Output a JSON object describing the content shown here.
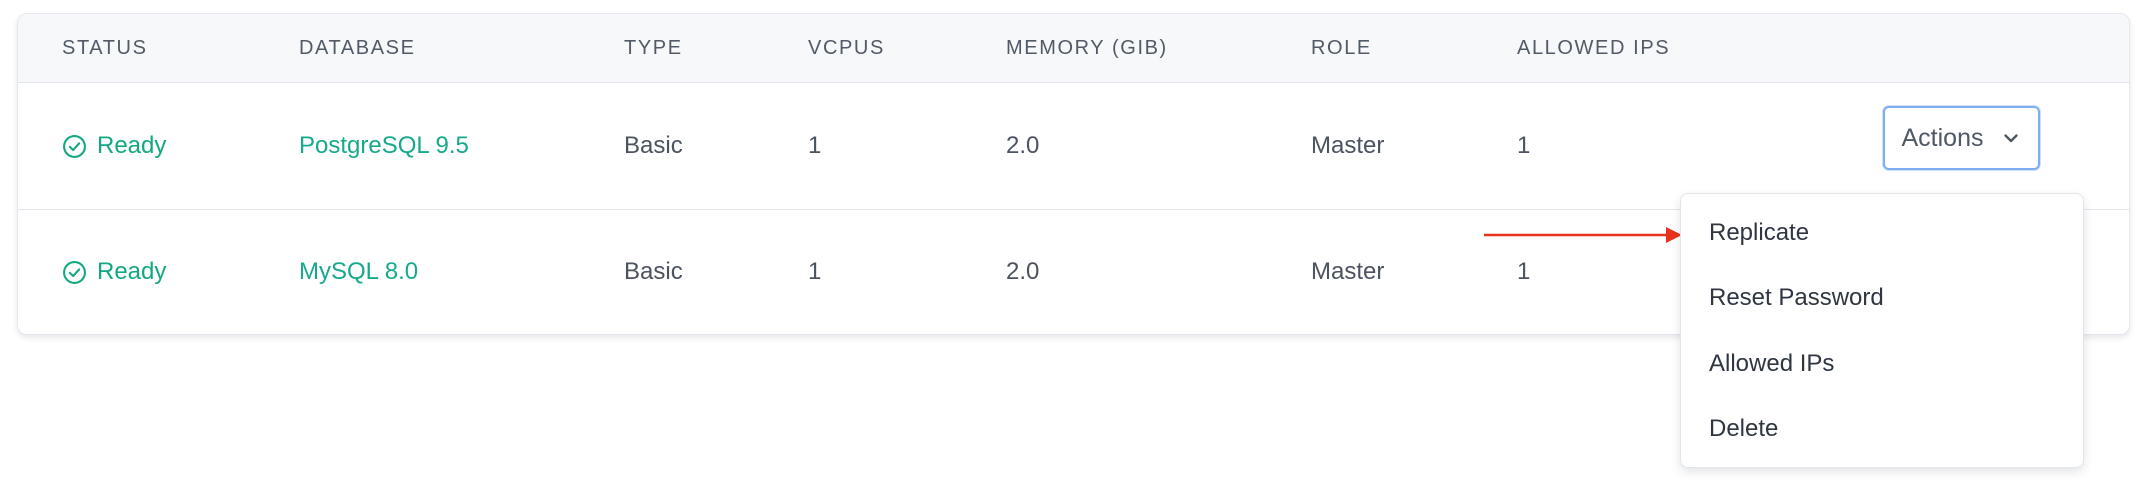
{
  "table": {
    "columns": {
      "status": "STATUS",
      "database": "DATABASE",
      "type": "TYPE",
      "vcpus": "VCPUS",
      "memory": "MEMORY (GIB)",
      "role": "ROLE",
      "allowed_ips": "ALLOWED IPS"
    },
    "rows": [
      {
        "status": "Ready",
        "database": "PostgreSQL 9.5",
        "type": "Basic",
        "vcpus": "1",
        "memory": "2.0",
        "role": "Master",
        "allowed_ips": "1",
        "actions_label": "Actions"
      },
      {
        "status": "Ready",
        "database": "MySQL 8.0",
        "type": "Basic",
        "vcpus": "1",
        "memory": "2.0",
        "role": "Master",
        "allowed_ips": "1"
      }
    ]
  },
  "actions_menu": {
    "items": [
      "Replicate",
      "Reset Password",
      "Allowed IPs",
      "Delete"
    ]
  },
  "icons": {
    "status": "check-circle-icon",
    "actions_toggle": "chevron-down-icon",
    "annotation": "red-arrow-annotation"
  },
  "colors": {
    "status_ready": "#14a882",
    "database_link": "#17a98c",
    "focus_border": "#7eaef0",
    "annotation_arrow": "#e8321e"
  }
}
